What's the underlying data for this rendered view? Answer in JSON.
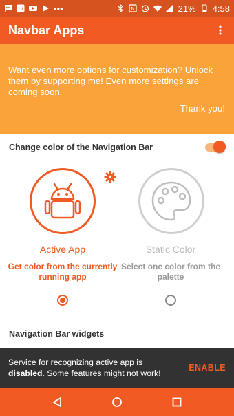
{
  "status_bar": {
    "battery_percent": "21%",
    "time": "4:58",
    "left_icons": [
      "chat-icon",
      "hangouts-icon",
      "youtube-icon",
      "play-store-icon",
      "dots-icon"
    ],
    "right_icons": [
      "bluetooth-icon",
      "nfc-icon",
      "alarm-icon",
      "wifi-icon",
      "signal-icon",
      "battery-icon"
    ]
  },
  "app_bar": {
    "title": "Navbar Apps"
  },
  "promo": {
    "message": "Want even more options for customization? Unlock them by supporting me! Even more settings are coming soon.",
    "thanks": "Thank you!"
  },
  "color_section": {
    "title": "Change color of the Navigation Bar",
    "toggle_on": true,
    "options": [
      {
        "label": "Active App",
        "description": "Get color from the currently running app",
        "selected": true
      },
      {
        "label": "Static Color",
        "description": "Select one color from the palette",
        "selected": false
      }
    ]
  },
  "widgets_section": {
    "title": "Navigation Bar widgets"
  },
  "snackbar": {
    "message_prefix": "Service for recognizing active app is ",
    "message_status": "disabled",
    "message_suffix": ". Some features might not work!",
    "action": "ENABLE"
  },
  "colors": {
    "accent": "#f15a22",
    "status_bar": "#d6531f",
    "promo_bg": "#f9a33a",
    "snackbar_bg": "#323232"
  }
}
